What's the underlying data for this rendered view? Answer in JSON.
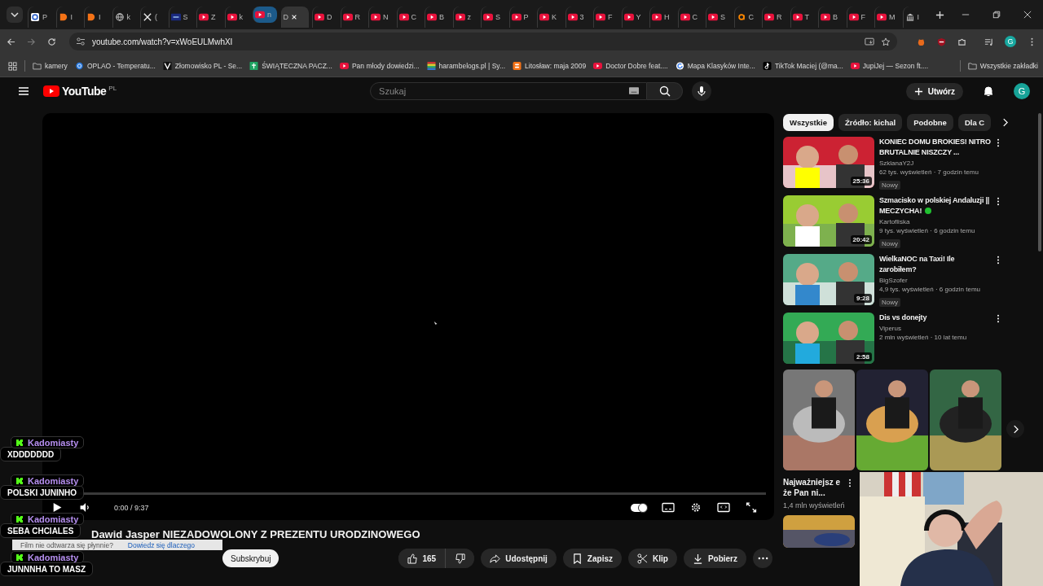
{
  "browser": {
    "tabs": [
      {
        "kind": "google",
        "title": "P",
        "selected": false,
        "highlighted": false
      },
      {
        "kind": "blogger",
        "title": "I",
        "selected": false,
        "highlighted": false
      },
      {
        "kind": "blogger",
        "title": "I",
        "selected": false,
        "highlighted": false
      },
      {
        "kind": "globe",
        "title": "k",
        "selected": false,
        "highlighted": false
      },
      {
        "kind": "x",
        "title": "(",
        "selected": false,
        "highlighted": false
      },
      {
        "kind": "badge",
        "title": "S",
        "selected": false,
        "highlighted": false
      },
      {
        "kind": "video",
        "title": "Z",
        "selected": false,
        "highlighted": false
      },
      {
        "kind": "video",
        "title": "k",
        "selected": false,
        "highlighted": false
      },
      {
        "kind": "video",
        "title": "n",
        "selected": false,
        "highlighted": true
      },
      {
        "kind": "none",
        "title": "D",
        "selected": true,
        "highlighted": false
      },
      {
        "kind": "video",
        "title": "D",
        "selected": false,
        "highlighted": false
      },
      {
        "kind": "video",
        "title": "R",
        "selected": false,
        "highlighted": false
      },
      {
        "kind": "video",
        "title": "N",
        "selected": false,
        "highlighted": false
      },
      {
        "kind": "video",
        "title": "C",
        "selected": false,
        "highlighted": false
      },
      {
        "kind": "video",
        "title": "B",
        "selected": false,
        "highlighted": false
      },
      {
        "kind": "video",
        "title": "z",
        "selected": false,
        "highlighted": false
      },
      {
        "kind": "video",
        "title": "S",
        "selected": false,
        "highlighted": false
      },
      {
        "kind": "video",
        "title": "P",
        "selected": false,
        "highlighted": false
      },
      {
        "kind": "video",
        "title": "K",
        "selected": false,
        "highlighted": false
      },
      {
        "kind": "video",
        "title": "3",
        "selected": false,
        "highlighted": false
      },
      {
        "kind": "video",
        "title": "F",
        "selected": false,
        "highlighted": false
      },
      {
        "kind": "video",
        "title": "Y",
        "selected": false,
        "highlighted": false
      },
      {
        "kind": "video",
        "title": "H",
        "selected": false,
        "highlighted": false
      },
      {
        "kind": "video",
        "title": "C",
        "selected": false,
        "highlighted": false
      },
      {
        "kind": "video",
        "title": "S",
        "selected": false,
        "highlighted": false
      },
      {
        "kind": "arc",
        "title": "C",
        "selected": false,
        "highlighted": false
      },
      {
        "kind": "video",
        "title": "R",
        "selected": false,
        "highlighted": false
      },
      {
        "kind": "video",
        "title": "T",
        "selected": false,
        "highlighted": false
      },
      {
        "kind": "video",
        "title": "B",
        "selected": false,
        "highlighted": false
      },
      {
        "kind": "video",
        "title": "F",
        "selected": false,
        "highlighted": false
      },
      {
        "kind": "video",
        "title": "M",
        "selected": false,
        "highlighted": false
      },
      {
        "kind": "bank",
        "title": "I",
        "selected": false,
        "highlighted": false
      }
    ],
    "url": "youtube.com/watch?v=xWoEULMwhXI",
    "profile": "G",
    "bookmarks": [
      {
        "kind": "folder",
        "label": "kamery"
      },
      {
        "kind": "ring",
        "label": "OPLAO - Temperatu..."
      },
      {
        "kind": "square",
        "label": "Złomowisko PL - Se..."
      },
      {
        "kind": "sheet",
        "label": "ŚWIĄTECZNA PACZ..."
      },
      {
        "kind": "video",
        "label": "Pan młody dowiedzi..."
      },
      {
        "kind": "stripes",
        "label": "harambelogs.pl | Sy..."
      },
      {
        "kind": "blogger",
        "label": "Litosław: maja 2009"
      },
      {
        "kind": "video",
        "label": "Doctor Dobre feat...."
      },
      {
        "kind": "google",
        "label": "Mapa Klasyków Inte..."
      },
      {
        "kind": "note",
        "label": "TikTok Maciej (@ma..."
      },
      {
        "kind": "video",
        "label": "JupiJej — Sezon ft...."
      }
    ],
    "all_bookmarks": "Wszystkie zakładki"
  },
  "header": {
    "logo": "YouTube",
    "region": "PL",
    "search_placeholder": "Szukaj",
    "create": "Utwórz",
    "avatar": "G"
  },
  "player": {
    "time": "0:00 / 9:37",
    "autoplay": true,
    "level": 0
  },
  "video": {
    "title": "Dawid Jasper NIEZADOWOLONY Z PREZENTU URODZINOWEGO",
    "subscribe": "Subskrybuj",
    "likes": "165",
    "actions": [
      {
        "kind": "share",
        "label": "Udostępnij"
      },
      {
        "kind": "save",
        "label": "Zapisz"
      },
      {
        "kind": "clip",
        "label": "Klip"
      },
      {
        "kind": "download",
        "label": "Pobierz"
      }
    ]
  },
  "notice": {
    "text": "Film nie odtwarza się płynnie?",
    "link": "Dowiedz się dlaczego"
  },
  "chips": [
    {
      "label": "Wszystkie",
      "selected": true
    },
    {
      "label": "Źródło: kichal",
      "selected": false
    },
    {
      "label": "Podobne",
      "selected": false
    },
    {
      "label": "Dla C",
      "selected": false
    }
  ],
  "related": [
    {
      "title": "KONIEC DOMU BROKIES! NITRO BRUTALNIE NISZCZY ...",
      "duration": "25:36",
      "channel": "SzklanaY2J",
      "meta": "62 tys. wyświetleń · 7 godzin temu",
      "badge": "Nowy",
      "live_dot": false
    },
    {
      "title": "Szmacisko w polskiej Andaluzji || MECZYCHA!",
      "duration": "20:42",
      "channel": "Kartofliska",
      "meta": "9 tys. wyświetleń · 6 godzin temu",
      "badge": "Nowy",
      "live_dot": true
    },
    {
      "title": "WielkaNOC na Taxi! Ile zarobiłem?",
      "duration": "9:28",
      "channel": "BigSzofer",
      "meta": "4,9 tys. wyświetleń · 6 godzin temu",
      "badge": "Nowy",
      "live_dot": false
    },
    {
      "title": "Dis vs donejty",
      "duration": "2:58",
      "channel": "Viperus",
      "meta": "2 mln wyświetleń · 10 lat temu",
      "live_dot": false
    }
  ],
  "shorts": {
    "items": [
      {
        "title": "Najważniejsz e że Pan ni...",
        "views": "1,4 mln wyświetleń"
      }
    ]
  },
  "chat": [
    {
      "author": "Kadomiasty",
      "text": "XDDDDDDD"
    },
    {
      "author": "Kadomiasty",
      "text": "POLSKI JUNINHO"
    },
    {
      "author": "Kadomiasty",
      "text": "SEBA CHCIALES"
    },
    {
      "author": "Kadomiasty",
      "text": "JUNNNHA TO MASZ"
    }
  ]
}
